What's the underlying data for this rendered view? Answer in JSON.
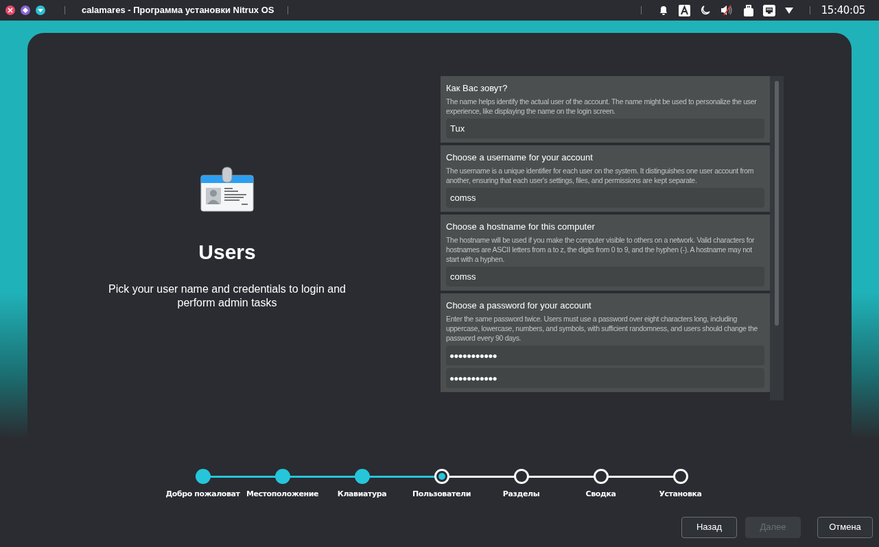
{
  "topbar": {
    "title": "calamares - Программа установки Nitrux OS",
    "clock": "15:40:05"
  },
  "page": {
    "title": "Users",
    "subtitle": "Pick your user name and credentials to login and perform admin tasks"
  },
  "sections": [
    {
      "title": "Как Вас зовут?",
      "description": "The name helps identify the actual user of the account. The name might be used to personalize the user experience, like displaying the name on the login screen.",
      "fields": [
        {
          "kind": "text",
          "value": "Tux"
        }
      ]
    },
    {
      "title": "Choose a username for your account",
      "description": "The username is a unique identifier for each user on the system. It distinguishes one user account from another, ensuring that each user's settings, files, and permissions are kept separate.",
      "fields": [
        {
          "kind": "text",
          "value": "comss"
        }
      ]
    },
    {
      "title": "Choose a hostname for this computer",
      "description": "The hostname will be used if you make the computer visible to others on a network. Valid characters for hostnames are ASCII letters from a to z, the digits from 0 to 9, and the hyphen (-). A hostname may not start with a hyphen.",
      "fields": [
        {
          "kind": "text",
          "value": "comss"
        }
      ]
    },
    {
      "title": "Choose a password for your account",
      "description": "Enter the same password twice. Users must use a password over eight characters long, including uppercase, lowercase, numbers, and symbols, with sufficient randomness, and users should change the password every 90 days.",
      "fields": [
        {
          "kind": "password",
          "value": "●●●●●●●●●●●"
        },
        {
          "kind": "password",
          "value": "●●●●●●●●●●●"
        }
      ]
    }
  ],
  "steps": [
    {
      "label": "Добро пожаловат",
      "completed": true,
      "selected": false
    },
    {
      "label": "Местоположение",
      "completed": true,
      "selected": false
    },
    {
      "label": "Клавиатура",
      "completed": true,
      "selected": false
    },
    {
      "label": "Пользователи",
      "completed": false,
      "selected": true
    },
    {
      "label": "Разделы",
      "completed": false,
      "selected": false
    },
    {
      "label": "Сводка",
      "completed": false,
      "selected": false
    },
    {
      "label": "Установка",
      "completed": false,
      "selected": false
    }
  ],
  "buttons": [
    {
      "label": "Назад",
      "disabled": false
    },
    {
      "label": "Далее",
      "disabled": true
    },
    {
      "label": "Отмена",
      "disabled": false
    }
  ]
}
